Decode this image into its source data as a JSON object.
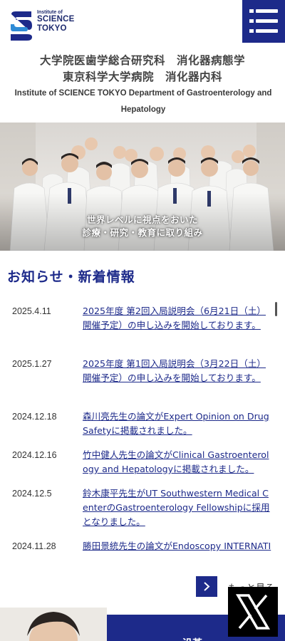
{
  "header": {
    "logo_small": "Institute of",
    "logo_line1": "SCIENCE",
    "logo_line2": "TOKYO",
    "title_jp_line1": "大学院医歯学総合研究科　消化器病態学",
    "title_jp_line2": "東京科学大学病院　消化器内科",
    "title_en": "Institute of SCIENCE TOKYO Department of Gastroenterology and Hepatology",
    "menu_icon": "menu-icon",
    "brand_color": "#1d2a8a"
  },
  "hero": {
    "caption_line1": "世界レベルに視点をおいた",
    "caption_line2": "診療・研究・教育に取り組み"
  },
  "news": {
    "heading": "お知らせ・新着情報",
    "items": [
      {
        "date": "2025.4.11",
        "title": "2025年度 第2回入局説明会（6月21日（土）開催予定）の申し込みを開始しております。"
      },
      {
        "date": "2025.1.27",
        "title": "2025年度 第1回入局説明会（3月22日（土）開催予定）の申し込みを開始しております。"
      },
      {
        "date": "2024.12.18",
        "title": "森川亮先生の論文がExpert Opinion on Drug Safetyに掲載されました。"
      },
      {
        "date": "2024.12.16",
        "title": "竹中健人先生の論文がClinical Gastroenterology and Hepatologyに掲載されました。"
      },
      {
        "date": "2024.12.5",
        "title": "鈴木康平先生がUT Southwestern Medical CenterのGastroenterology Fellowshipに採用となりました。"
      },
      {
        "date": "2024.11.28",
        "title": "勝田景統先生の論文がEndoscopy INTERNATIONAL OPENに掲載されました。"
      }
    ],
    "more_label": "もっと見る",
    "more_icon": "chevron-right-icon"
  },
  "footer": {
    "dept_banner_label": "沿革",
    "x_icon": "x-logo-icon"
  }
}
